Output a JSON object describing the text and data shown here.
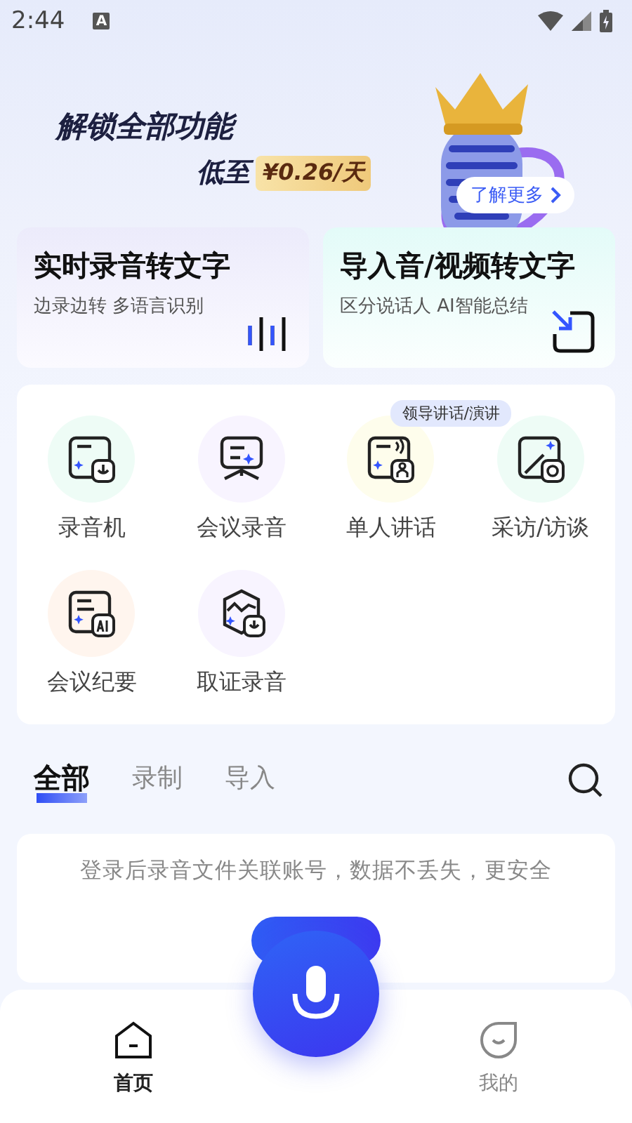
{
  "status_bar": {
    "time": "2:44",
    "input_indicator": "A"
  },
  "banner": {
    "title": "解锁全部功能",
    "price_prefix": "低至",
    "price": "¥0.26/天",
    "more_button": "了解更多"
  },
  "feature_cards": [
    {
      "kind": "realtime",
      "title": "实时录音转文字",
      "subtitle": "边录边转 多语言识别"
    },
    {
      "kind": "import",
      "title": "导入音/视频转文字",
      "subtitle": "区分说话人 AI智能总结"
    }
  ],
  "tools": [
    {
      "kind": "recorder",
      "label": "录音机",
      "color": "#eefcf6"
    },
    {
      "kind": "meeting",
      "label": "会议录音",
      "color": "#f8f4ff"
    },
    {
      "kind": "speech",
      "label": "单人讲话",
      "color": "#fefdec",
      "badge": "领导讲话/演讲"
    },
    {
      "kind": "interview",
      "label": "采访/访谈",
      "color": "#eefcf6"
    },
    {
      "kind": "minutes",
      "label": "会议纪要",
      "color": "#fff5ee"
    },
    {
      "kind": "evidence",
      "label": "取证录音",
      "color": "#f8f4ff"
    }
  ],
  "tabs": [
    {
      "label": "全部",
      "selected": true
    },
    {
      "label": "录制",
      "selected": false
    },
    {
      "label": "导入",
      "selected": false
    }
  ],
  "login_card": {
    "message": "登录后录音文件关联账号，数据不丢失，更安全"
  },
  "nav": [
    {
      "kind": "home",
      "label": "首页",
      "selected": true
    },
    {
      "kind": "me",
      "label": "我的",
      "selected": false
    }
  ]
}
